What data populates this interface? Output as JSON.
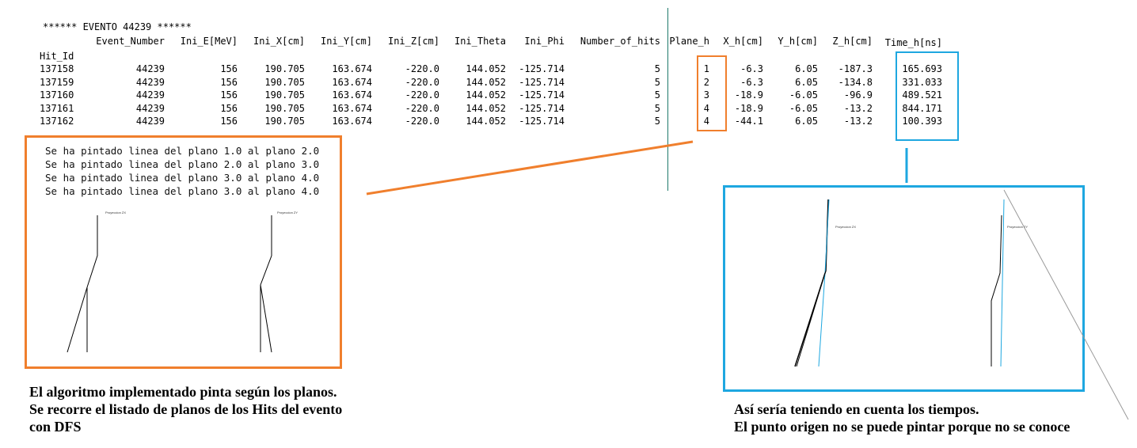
{
  "event_header": "****** EVENTO 44239 ******",
  "table": {
    "columns": [
      "Event_Number",
      "Ini_E[MeV]",
      "Ini_X[cm]",
      "Ini_Y[cm]",
      "Ini_Z[cm]",
      "Ini_Theta",
      "Ini_Phi",
      "Number_of_hits",
      "Plane_h",
      "X_h[cm]",
      "Y_h[cm]",
      "Z_h[cm]",
      "Time_h[ns]"
    ],
    "index_label": "Hit_Id",
    "rows": [
      [
        "137158",
        "44239",
        "156",
        "190.705",
        "163.674",
        "-220.0",
        "144.052",
        "-125.714",
        "5",
        "1",
        "-6.3",
        "6.05",
        "-187.3",
        "165.693"
      ],
      [
        "137159",
        "44239",
        "156",
        "190.705",
        "163.674",
        "-220.0",
        "144.052",
        "-125.714",
        "5",
        "2",
        "-6.3",
        "6.05",
        "-134.8",
        "331.033"
      ],
      [
        "137160",
        "44239",
        "156",
        "190.705",
        "163.674",
        "-220.0",
        "144.052",
        "-125.714",
        "5",
        "3",
        "-18.9",
        "-6.05",
        "-96.9",
        "489.521"
      ],
      [
        "137161",
        "44239",
        "156",
        "190.705",
        "163.674",
        "-220.0",
        "144.052",
        "-125.714",
        "5",
        "4",
        "-18.9",
        "-6.05",
        "-13.2",
        "844.171"
      ],
      [
        "137162",
        "44239",
        "156",
        "190.705",
        "163.674",
        "-220.0",
        "144.052",
        "-125.714",
        "5",
        "4",
        "-44.1",
        "6.05",
        "-13.2",
        "100.393"
      ]
    ]
  },
  "dfs_messages": [
    "Se ha pintado linea del plano 1.0 al plano 2.0",
    "Se ha pintado linea del plano 2.0 al plano 3.0",
    "Se ha pintado linea del plano 3.0 al plano 4.0",
    "Se ha pintado linea del plano 3.0 al plano 4.0"
  ],
  "plot_labels": {
    "zx": "Proyeccion ZX",
    "zy": "Proyeccion ZY"
  },
  "captions": {
    "left": [
      "El algoritmo implementado pinta según los planos.",
      "Se recorre el listado de planos de los Hits del evento",
      "con DFS"
    ],
    "right": [
      "Así sería teniendo en cuenta los tiempos.",
      "El punto origen no se puede pintar porque no se conoce"
    ]
  },
  "colors": {
    "orange": "#f07f2d",
    "blue": "#1ea7e0",
    "divider": "#1f7a6b"
  }
}
